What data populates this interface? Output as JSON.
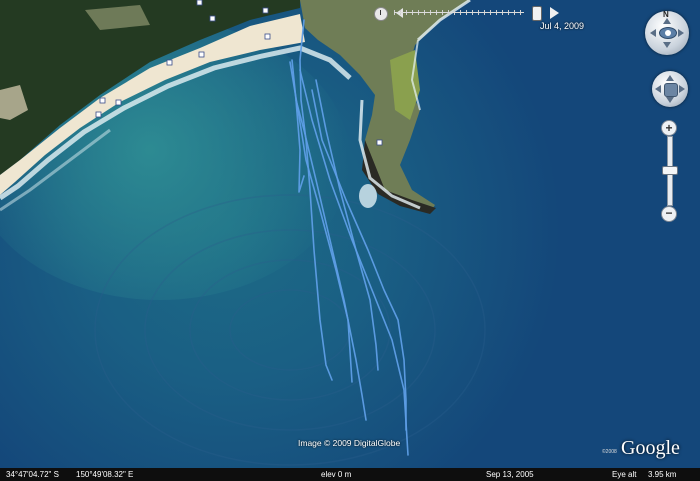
{
  "time_slider": {
    "date_label": "Jul  4, 2009",
    "icons": [
      "clock-icon",
      "slider-prev-icon",
      "slider-next-icon"
    ]
  },
  "navigation": {
    "north_label": "N",
    "zoom_in_label": "+",
    "zoom_out_label": "−",
    "icons": [
      "eye-icon",
      "hand-icon",
      "north-arrow-icon"
    ]
  },
  "credits": {
    "imagery": "Image © 2009 DigitalGlobe",
    "logo": "Google",
    "copyright": "©2008"
  },
  "status_bar": {
    "latitude": "34°47'04.72\" S",
    "longitude": "150°49'08.32\" E",
    "elevation": "elev    0 m",
    "imagery_date": "Sep 13, 2005",
    "eye_alt_label": "Eye alt",
    "eye_alt_value": "3.95 km"
  },
  "colors": {
    "ocean_deep": "#14477a",
    "ocean_bay": "#1f6b88",
    "track": "#5e9ee6",
    "sand": "#efe6d1",
    "forest": "#243a22",
    "status_bar": "#0e0e0e"
  }
}
